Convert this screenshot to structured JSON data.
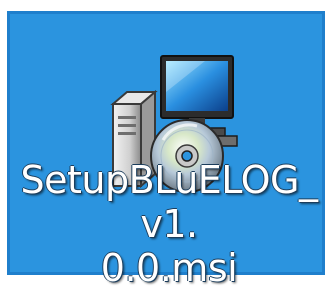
{
  "desktop_item": {
    "filename": "SetupBLuELOG_v1.0.0.msi",
    "label_line1": "SetupBLuELOG_v1.",
    "label_line2": "0.0.msi",
    "icon": "msi-installer-icon",
    "selected": true,
    "selection_color": "#2b94df"
  }
}
